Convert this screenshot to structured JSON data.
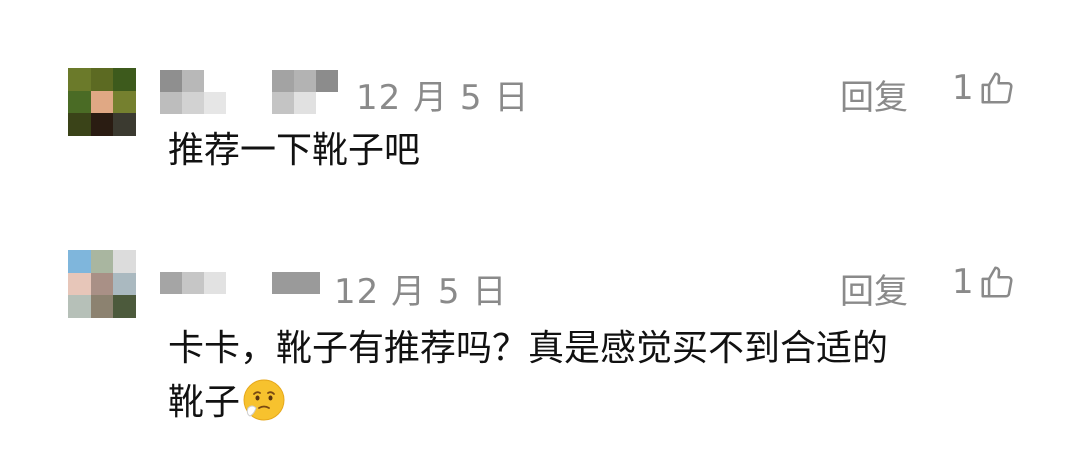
{
  "comments": [
    {
      "date": "12 月 5 日",
      "reply_label": "回复",
      "likes": "1",
      "text": "推荐一下靴子吧",
      "avatar_colors": [
        "#6b7a2a",
        "#5c6a22",
        "#3d5a1c",
        "#4a6b25",
        "#e0a884",
        "#75802f",
        "#3a4318",
        "#2a1c12",
        "#3b3a30"
      ]
    },
    {
      "date": "12 月 5 日",
      "reply_label": "回复",
      "likes": "1",
      "text_line1": "卡卡，靴子有推荐吗？真是感觉买不到合适的",
      "text_line2": "靴子",
      "emoji": "sad-face-emoji",
      "avatar_colors": [
        "#7fb6dc",
        "#a9b6a0",
        "#dcdcdc",
        "#e7c6b9",
        "#a99086",
        "#aab9c0",
        "#b6c0b8",
        "#8c8270",
        "#4c5a3c"
      ]
    }
  ],
  "colors": {
    "meta": "#8a8a8a",
    "text": "#111111"
  }
}
